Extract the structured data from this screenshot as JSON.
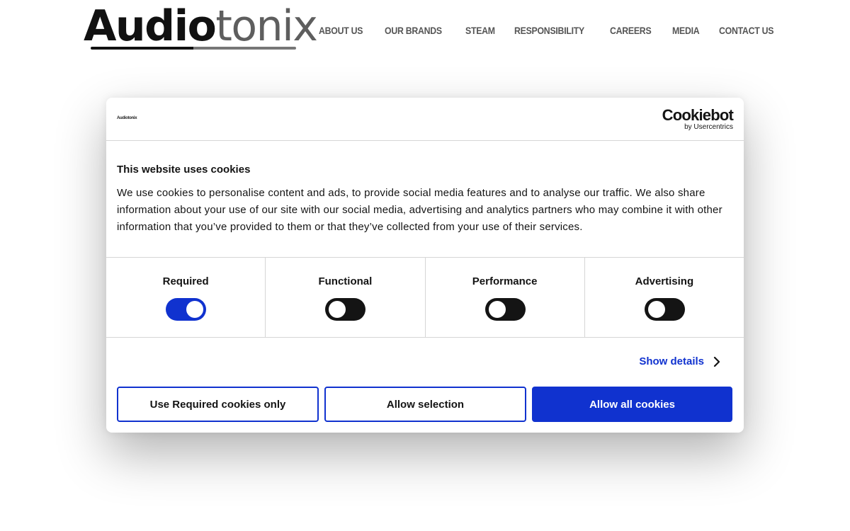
{
  "header": {
    "logo": {
      "part1": "Audio",
      "part2": "tonix"
    },
    "nav": [
      "ABOUT US",
      "OUR BRANDS",
      "STEAM",
      "RESPONSIBILITY",
      "CAREERS",
      "MEDIA",
      "CONTACT US"
    ]
  },
  "cookie_dialog": {
    "mini_logo": "Audiotonix",
    "provider": {
      "name": "Cookiebot",
      "byline": "by Usercentrics"
    },
    "title": "This website uses cookies",
    "text": "We use cookies to personalise content and ads, to provide social media features and to analyse our traffic. We also share information about your use of our site with our social media, advertising and analytics partners who may combine it with other information that you’ve provided to them or that they’ve collected from your use of their services.",
    "toggles": [
      {
        "label": "Required",
        "on": true
      },
      {
        "label": "Functional",
        "on": false
      },
      {
        "label": "Performance",
        "on": false
      },
      {
        "label": "Advertising",
        "on": false
      }
    ],
    "show_details": "Show details",
    "buttons": {
      "required_only": "Use Required cookies only",
      "allow_selection": "Allow selection",
      "allow_all": "Allow all cookies"
    },
    "colors": {
      "accent": "#1032cf",
      "text": "#141414",
      "toggle_off": "#141414"
    }
  }
}
